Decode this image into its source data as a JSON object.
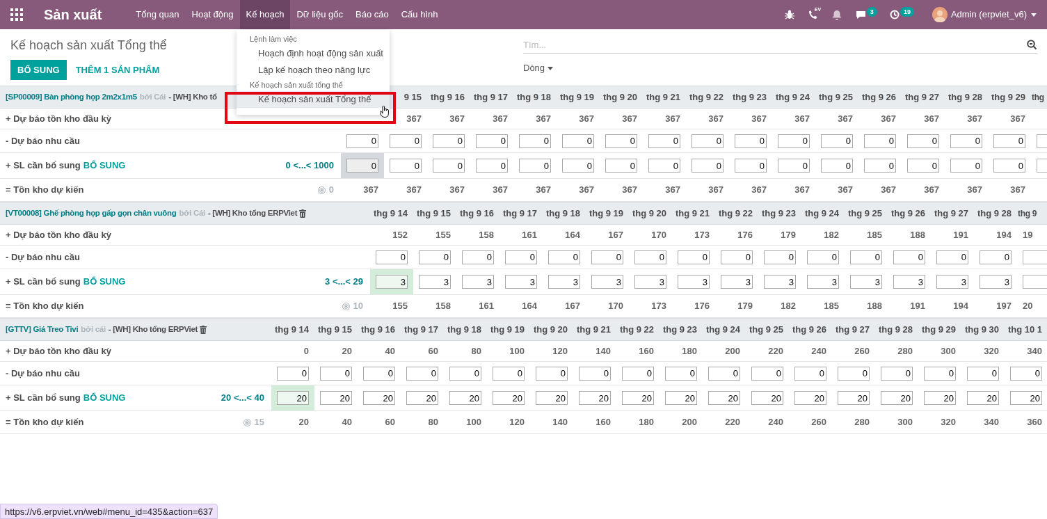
{
  "navbar": {
    "app_title": "Sản xuất",
    "menu": [
      {
        "label": "Tổng quan",
        "selected": false
      },
      {
        "label": "Hoạt động",
        "selected": false
      },
      {
        "label": "Kế hoạch",
        "selected": true
      },
      {
        "label": "Dữ liệu gốc",
        "selected": false
      },
      {
        "label": "Báo cáo",
        "selected": false
      },
      {
        "label": "Cấu hình",
        "selected": false
      }
    ],
    "phone_badge": "EV",
    "chat_count": "3",
    "activity_count": "19",
    "user": "Admin (erpviet_v6)"
  },
  "breadcrumb": "Kế hoạch sản xuất Tổng thể",
  "buttons": [
    {
      "label": "BỔ SUNG",
      "kind": "primary"
    },
    {
      "label": "THÊM 1 SẢN PHẨM",
      "kind": "link"
    }
  ],
  "search": {
    "placeholder": "Tìm..."
  },
  "group_by": "Dòng",
  "products": [
    {
      "code": "[SP00009] Bàn phòng họp 2m2x1m5",
      "uom": "bởi Cái",
      "warehouse": "- [WH] Kho tổ",
      "trash": false,
      "focused": true,
      "suggested": false,
      "labels": {
        "start": "+ Dự báo tồn kho đầu kỳ",
        "demand": "- Dự báo nhu cầu",
        "replenish": "+ SL cần bổ sung",
        "replenish_action": "BỔ SUNG",
        "forecast": "= Tồn kho dự kiến"
      },
      "range": "0 <...< 1000",
      "safety": "0",
      "columns": [
        {
          "demand": "0",
          "replenish": "0",
          "forecast": "367"
        },
        {
          "date": "9 15",
          "start": "367",
          "demand": "0",
          "replenish": "0",
          "forecast": "367"
        },
        {
          "date": "thg 9 16",
          "start": "367",
          "demand": "0",
          "replenish": "0",
          "forecast": "367"
        },
        {
          "date": "thg 9 17",
          "start": "367",
          "demand": "0",
          "replenish": "0",
          "forecast": "367"
        },
        {
          "date": "thg 9 18",
          "start": "367",
          "demand": "0",
          "replenish": "0",
          "forecast": "367"
        },
        {
          "date": "thg 9 19",
          "start": "367",
          "demand": "0",
          "replenish": "0",
          "forecast": "367"
        },
        {
          "date": "thg 9 20",
          "start": "367",
          "demand": "0",
          "replenish": "0",
          "forecast": "367"
        },
        {
          "date": "thg 9 21",
          "start": "367",
          "demand": "0",
          "replenish": "0",
          "forecast": "367"
        },
        {
          "date": "thg 9 22",
          "start": "367",
          "demand": "0",
          "replenish": "0",
          "forecast": "367"
        },
        {
          "date": "thg 9 23",
          "start": "367",
          "demand": "0",
          "replenish": "0",
          "forecast": "367"
        },
        {
          "date": "thg 9 24",
          "start": "367",
          "demand": "0",
          "replenish": "0",
          "forecast": "367"
        },
        {
          "date": "thg 9 25",
          "start": "367",
          "demand": "0",
          "replenish": "0",
          "forecast": "367"
        },
        {
          "date": "thg 9 26",
          "start": "367",
          "demand": "0",
          "replenish": "0",
          "forecast": "367"
        },
        {
          "date": "thg 9 27",
          "start": "367",
          "demand": "0",
          "replenish": "0",
          "forecast": "367"
        },
        {
          "date": "thg 9 28",
          "start": "367",
          "demand": "0",
          "replenish": "0",
          "forecast": "367"
        },
        {
          "date": "thg 9 29",
          "start": "367",
          "demand": "0",
          "replenish": "0",
          "forecast": "367"
        },
        {
          "date": "thg"
        }
      ]
    },
    {
      "code": "[VT00008] Ghế phòng họp gấp gọn chân vuông",
      "uom": "bởi Cái",
      "warehouse": "- [WH] Kho tổng ERPViet",
      "trash": true,
      "focused": false,
      "suggested": true,
      "labels": {
        "start": "+ Dự báo tồn kho đầu kỳ",
        "demand": "- Dự báo nhu cầu",
        "replenish": "+ SL cần bổ sung",
        "replenish_action": "BỔ SUNG",
        "forecast": "= Tồn kho dự kiến"
      },
      "range": "3 <...< 29",
      "safety": "10",
      "columns": [
        {
          "date": "thg 9 14",
          "start": "152",
          "demand": "0",
          "replenish": "3",
          "forecast": "155"
        },
        {
          "date": "thg 9 15",
          "start": "155",
          "demand": "0",
          "replenish": "3",
          "forecast": "158"
        },
        {
          "date": "thg 9 16",
          "start": "158",
          "demand": "0",
          "replenish": "3",
          "forecast": "161"
        },
        {
          "date": "thg 9 17",
          "start": "161",
          "demand": "0",
          "replenish": "3",
          "forecast": "164"
        },
        {
          "date": "thg 9 18",
          "start": "164",
          "demand": "0",
          "replenish": "3",
          "forecast": "167"
        },
        {
          "date": "thg 9 19",
          "start": "167",
          "demand": "0",
          "replenish": "3",
          "forecast": "170"
        },
        {
          "date": "thg 9 20",
          "start": "170",
          "demand": "0",
          "replenish": "3",
          "forecast": "173"
        },
        {
          "date": "thg 9 21",
          "start": "173",
          "demand": "0",
          "replenish": "3",
          "forecast": "176"
        },
        {
          "date": "thg 9 22",
          "start": "176",
          "demand": "0",
          "replenish": "3",
          "forecast": "179"
        },
        {
          "date": "thg 9 23",
          "start": "179",
          "demand": "0",
          "replenish": "3",
          "forecast": "182"
        },
        {
          "date": "thg 9 24",
          "start": "182",
          "demand": "0",
          "replenish": "3",
          "forecast": "185"
        },
        {
          "date": "thg 9 25",
          "start": "185",
          "demand": "0",
          "replenish": "3",
          "forecast": "188"
        },
        {
          "date": "thg 9 26",
          "start": "188",
          "demand": "0",
          "replenish": "3",
          "forecast": "191"
        },
        {
          "date": "thg 9 27",
          "start": "191",
          "demand": "0",
          "replenish": "3",
          "forecast": "194"
        },
        {
          "date": "thg 9 28",
          "start": "194",
          "demand": "0",
          "replenish": "3",
          "forecast": "197"
        },
        {
          "date": "thg 9",
          "start": "19",
          "forecast": "20"
        }
      ]
    },
    {
      "code": "[GTTV] Giá Treo Tivi",
      "uom": "bởi cái",
      "warehouse": "- [WH] Kho tổng ERPViet",
      "trash": true,
      "focused": false,
      "suggested": true,
      "labels": {
        "start": "+ Dự báo tồn kho đầu kỳ",
        "demand": "- Dự báo nhu cầu",
        "replenish": "+ SL cần bổ sung",
        "replenish_action": "BỔ SUNG",
        "forecast": "= Tồn kho dự kiến"
      },
      "range": "20 <...< 40",
      "safety": "15",
      "columns": [
        {
          "date": "thg 9 14",
          "start": "0",
          "demand": "0",
          "replenish": "20",
          "forecast": "20"
        },
        {
          "date": "thg 9 15",
          "start": "20",
          "demand": "0",
          "replenish": "20",
          "forecast": "40"
        },
        {
          "date": "thg 9 16",
          "start": "40",
          "demand": "0",
          "replenish": "20",
          "forecast": "60"
        },
        {
          "date": "thg 9 17",
          "start": "60",
          "demand": "0",
          "replenish": "20",
          "forecast": "80"
        },
        {
          "date": "thg 9 18",
          "start": "80",
          "demand": "0",
          "replenish": "20",
          "forecast": "100"
        },
        {
          "date": "thg 9 19",
          "start": "100",
          "demand": "0",
          "replenish": "20",
          "forecast": "120"
        },
        {
          "date": "thg 9 20",
          "start": "120",
          "demand": "0",
          "replenish": "20",
          "forecast": "140"
        },
        {
          "date": "thg 9 21",
          "start": "140",
          "demand": "0",
          "replenish": "20",
          "forecast": "160"
        },
        {
          "date": "thg 9 22",
          "start": "160",
          "demand": "0",
          "replenish": "20",
          "forecast": "180"
        },
        {
          "date": "thg 9 23",
          "start": "180",
          "demand": "0",
          "replenish": "20",
          "forecast": "200"
        },
        {
          "date": "thg 9 24",
          "start": "200",
          "demand": "0",
          "replenish": "20",
          "forecast": "220"
        },
        {
          "date": "thg 9 25",
          "start": "220",
          "demand": "0",
          "replenish": "20",
          "forecast": "240"
        },
        {
          "date": "thg 9 26",
          "start": "240",
          "demand": "0",
          "replenish": "20",
          "forecast": "260"
        },
        {
          "date": "thg 9 27",
          "start": "260",
          "demand": "0",
          "replenish": "20",
          "forecast": "280"
        },
        {
          "date": "thg 9 28",
          "start": "280",
          "demand": "0",
          "replenish": "20",
          "forecast": "300"
        },
        {
          "date": "thg 9 29",
          "start": "300",
          "demand": "0",
          "replenish": "20",
          "forecast": "320"
        },
        {
          "date": "thg 9 30",
          "start": "320",
          "demand": "0",
          "replenish": "20",
          "forecast": "340"
        },
        {
          "date": "thg 10 1",
          "start": "340",
          "demand": "0",
          "replenish": "20",
          "forecast": "360"
        }
      ]
    }
  ],
  "dropdown": {
    "sections": [
      {
        "title": "Lệnh làm việc",
        "items": [
          {
            "label": "Hoạch định hoạt động sản xuất",
            "selected": false
          },
          {
            "label": "Lập kế hoạch theo năng lực",
            "selected": false
          }
        ]
      },
      {
        "title": "Kế hoạch sản xuất tổng thể",
        "items": [
          {
            "label": "Kế hoạch sản xuất Tổng thể",
            "selected": true
          }
        ]
      }
    ]
  },
  "highlight_frame": true,
  "status_url": "https://v6.erpviet.vn/web#menu_id=435&action=637"
}
